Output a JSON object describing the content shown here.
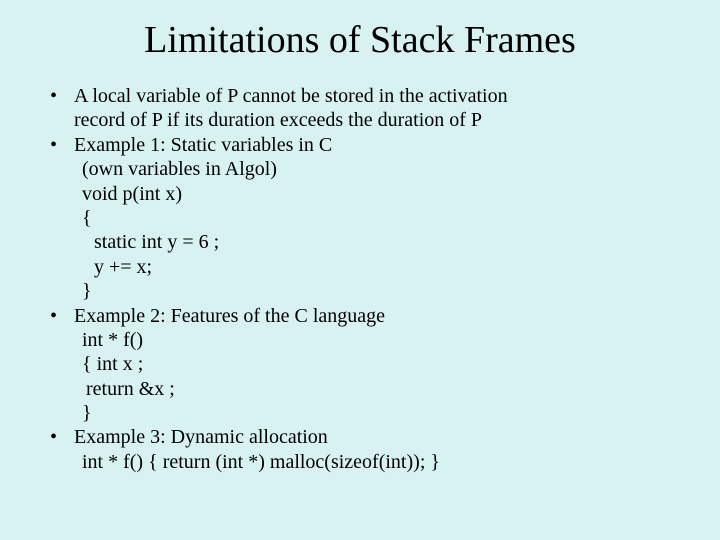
{
  "title": "Limitations of Stack Frames",
  "bullets": [
    {
      "lines": [
        {
          "text": "A local variable of P cannot be stored in the activation",
          "indent": ""
        },
        {
          "text": "record of P if its duration exceeds the duration of P",
          "indent": ""
        }
      ]
    },
    {
      "lines": [
        {
          "text": "Example 1: Static variables in C",
          "indent": ""
        },
        {
          "text": " (own variables in Algol)",
          "indent": "indent1"
        },
        {
          "text": "void p(int x)",
          "indent": "indent1"
        },
        {
          "text": "{",
          "indent": "indent1"
        },
        {
          "text": "static int y = 6 ;",
          "indent": "indent2"
        },
        {
          "text": "y += x;",
          "indent": "indent2"
        },
        {
          "text": "}",
          "indent": "indent1"
        }
      ]
    },
    {
      "lines": [
        {
          "text": "Example 2: Features of the C language",
          "indent": ""
        },
        {
          "text": "int * f()",
          "indent": "indent1"
        },
        {
          "text": "{ int x ;",
          "indent": "indent1"
        },
        {
          "text": "return &x ;",
          "indent": "indent3"
        },
        {
          "text": "}",
          "indent": "indent1"
        }
      ]
    },
    {
      "lines": [
        {
          "text": "Example 3: Dynamic allocation",
          "indent": ""
        },
        {
          "text": "int * f()  { return (int *) malloc(sizeof(int)); }",
          "indent": "indent1"
        }
      ]
    }
  ]
}
